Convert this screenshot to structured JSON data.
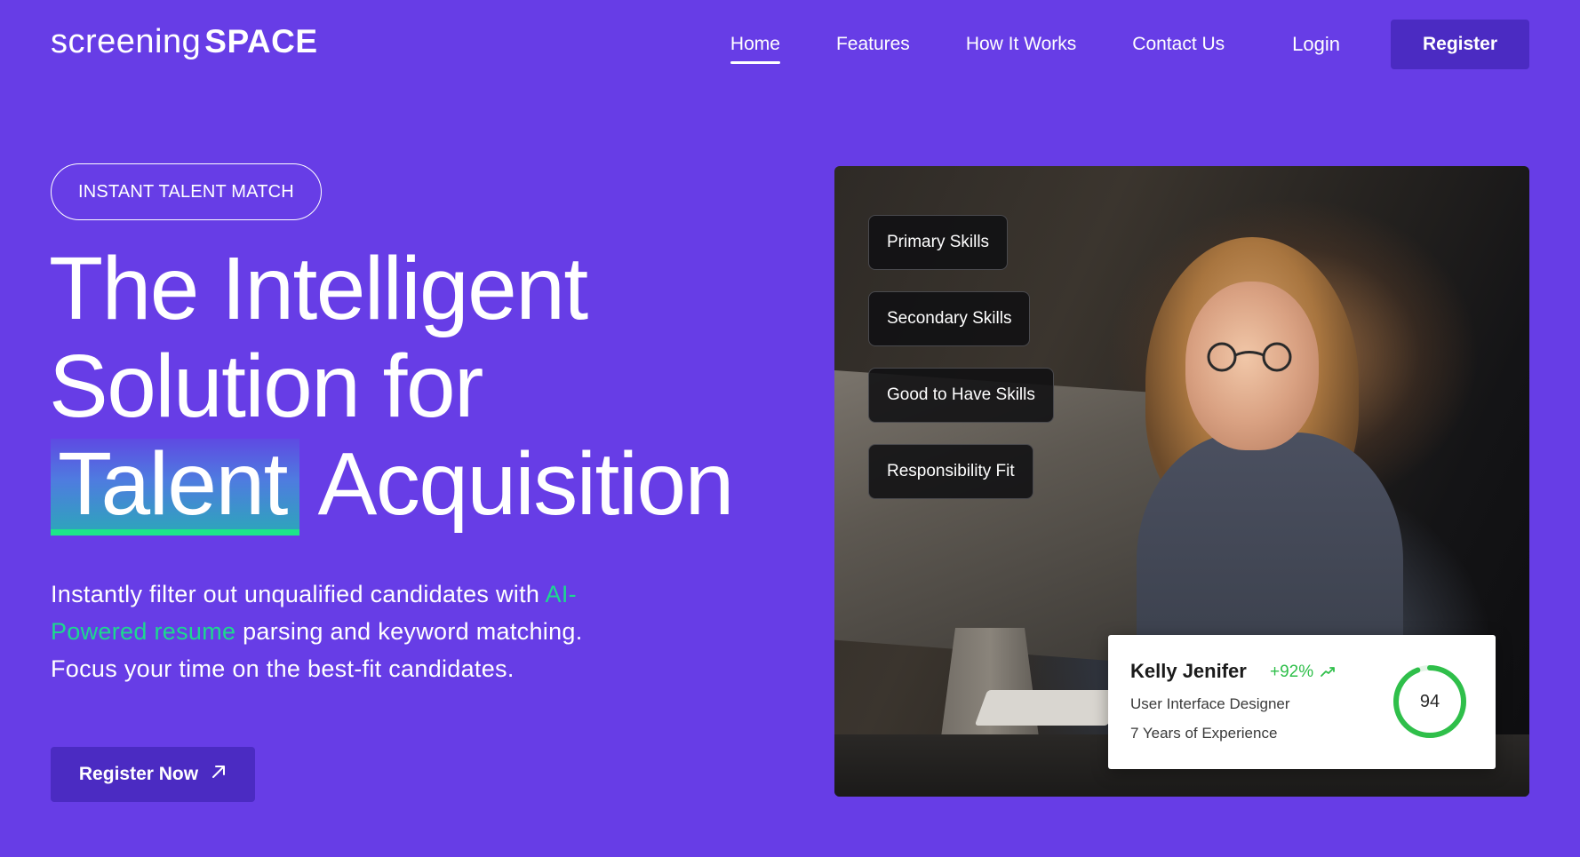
{
  "brand": {
    "light": "screening",
    "bold": "SPACE"
  },
  "nav": {
    "items": [
      {
        "label": "Home",
        "active": true
      },
      {
        "label": "Features",
        "active": false
      },
      {
        "label": "How It Works",
        "active": false
      },
      {
        "label": "Contact Us",
        "active": false
      }
    ],
    "login": "Login",
    "register": "Register"
  },
  "hero": {
    "badge": "INSTANT TALENT MATCH",
    "headline_line1": "The Intelligent",
    "headline_line2": "Solution for",
    "headline_highlight": "Talent",
    "headline_rest": "Acquisition",
    "desc_before": "Instantly filter out unqualified candidates with ",
    "desc_accent": "AI-Powered resume",
    "desc_after": " parsing and keyword matching. Focus your time on the best-fit candidates.",
    "cta": "Register Now"
  },
  "skills": [
    "Primary Skills",
    "Secondary Skills",
    "Good to Have Skills",
    "Responsibility Fit"
  ],
  "candidate": {
    "name": "Kelly Jenifer",
    "delta": "+92%",
    "role": "User Interface Designer",
    "experience": "7 Years of Experience",
    "score": "94",
    "score_fraction": 0.94
  },
  "colors": {
    "background": "#673de6",
    "button": "#4b2bc2",
    "accent_green": "#1dd88f",
    "score_green": "#2fbf4a"
  }
}
